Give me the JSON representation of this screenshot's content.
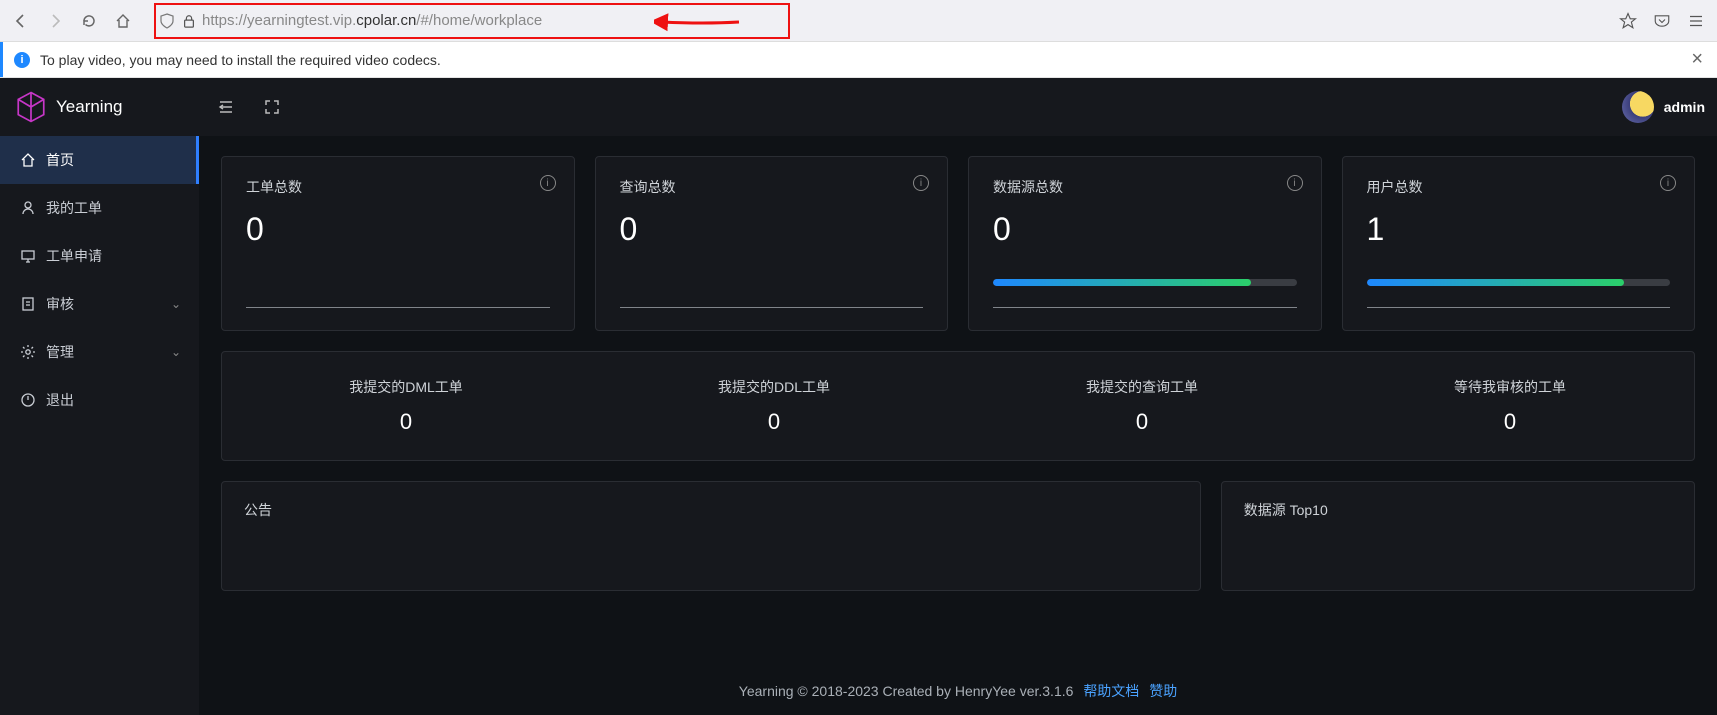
{
  "browser": {
    "url_pre": "https://yearningtest.vip.",
    "url_dark": "cpolar.cn",
    "url_post": "/#/home/workplace"
  },
  "codec_message": "To play video, you may need to install the required video codecs.",
  "logo_text": "Yearning",
  "user_name": "admin",
  "sidebar": {
    "items": [
      {
        "label": "首页"
      },
      {
        "label": "我的工单"
      },
      {
        "label": "工单申请"
      },
      {
        "label": "审核"
      },
      {
        "label": "管理"
      },
      {
        "label": "退出"
      }
    ]
  },
  "stats": [
    {
      "label": "工单总数",
      "value": "0",
      "has_progress": false
    },
    {
      "label": "查询总数",
      "value": "0",
      "has_progress": false
    },
    {
      "label": "数据源总数",
      "value": "0",
      "has_progress": true,
      "progress_pct": 85
    },
    {
      "label": "用户总数",
      "value": "1",
      "has_progress": true,
      "progress_pct": 85
    }
  ],
  "mid": [
    {
      "label": "我提交的DML工单",
      "value": "0"
    },
    {
      "label": "我提交的DDL工单",
      "value": "0"
    },
    {
      "label": "我提交的查询工单",
      "value": "0"
    },
    {
      "label": "等待我审核的工单",
      "value": "0"
    }
  ],
  "panels": {
    "announce": "公告",
    "top10": "数据源 Top10"
  },
  "footer": {
    "text": "Yearning © 2018-2023 Created by HenryYee ver.3.1.6",
    "link1": "帮助文档",
    "link2": "赞助"
  }
}
